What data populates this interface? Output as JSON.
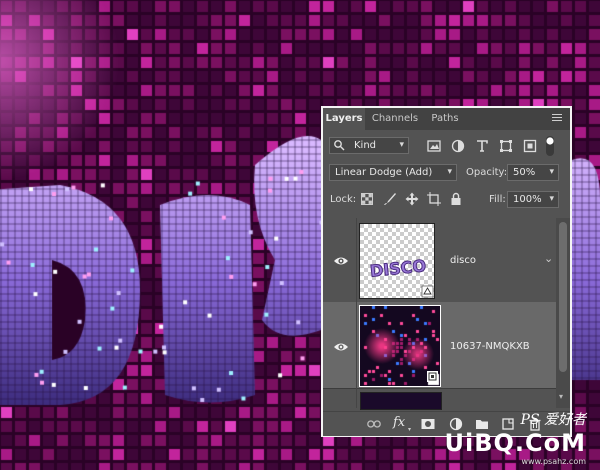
{
  "canvas": {
    "background": "#2a0226",
    "tile_colors": [
      "#5a0a4a",
      "#7a1060",
      "#a81a86",
      "#c2249c",
      "#3e0638",
      "#e040c0"
    ]
  },
  "panel": {
    "tabs": [
      {
        "label": "Layers",
        "active": true
      },
      {
        "label": "Channels",
        "active": false
      },
      {
        "label": "Paths",
        "active": false
      }
    ],
    "filter": {
      "label": "Kind",
      "icon": "search-icon"
    },
    "filter_icons": [
      "image-filter-icon",
      "adjustment-filter-icon",
      "type-filter-icon",
      "shape-filter-icon",
      "smart-object-filter-icon",
      "filter-toggle-icon"
    ],
    "blend_mode": "Linear Dodge (Add)",
    "opacity_label": "Opacity:",
    "opacity_value": "50%",
    "lock_label": "Lock:",
    "lock_icons": [
      "lock-transparent-pixels-icon",
      "lock-image-pixels-icon",
      "lock-position-icon",
      "lock-artboard-icon",
      "lock-all-icon"
    ],
    "fill_label": "Fill:",
    "fill_value": "100%",
    "layers": [
      {
        "name": "disco",
        "thumb_text": "DISCO",
        "visible": true,
        "selected": false,
        "smart_object": true
      },
      {
        "name": "10637-NMQKXB",
        "visible": true,
        "selected": true,
        "smart_object": true
      }
    ],
    "bottom_icons": [
      "link-layers-icon",
      "fx-icon",
      "add-mask-icon",
      "adjustment-layer-icon",
      "group-folder-icon",
      "new-layer-icon",
      "trash-icon"
    ],
    "fx_label": "fx"
  },
  "watermark": {
    "ps_text": "PS 爱好者",
    "logo": "UiBQ.CoM",
    "url": "www.psahz.com"
  }
}
